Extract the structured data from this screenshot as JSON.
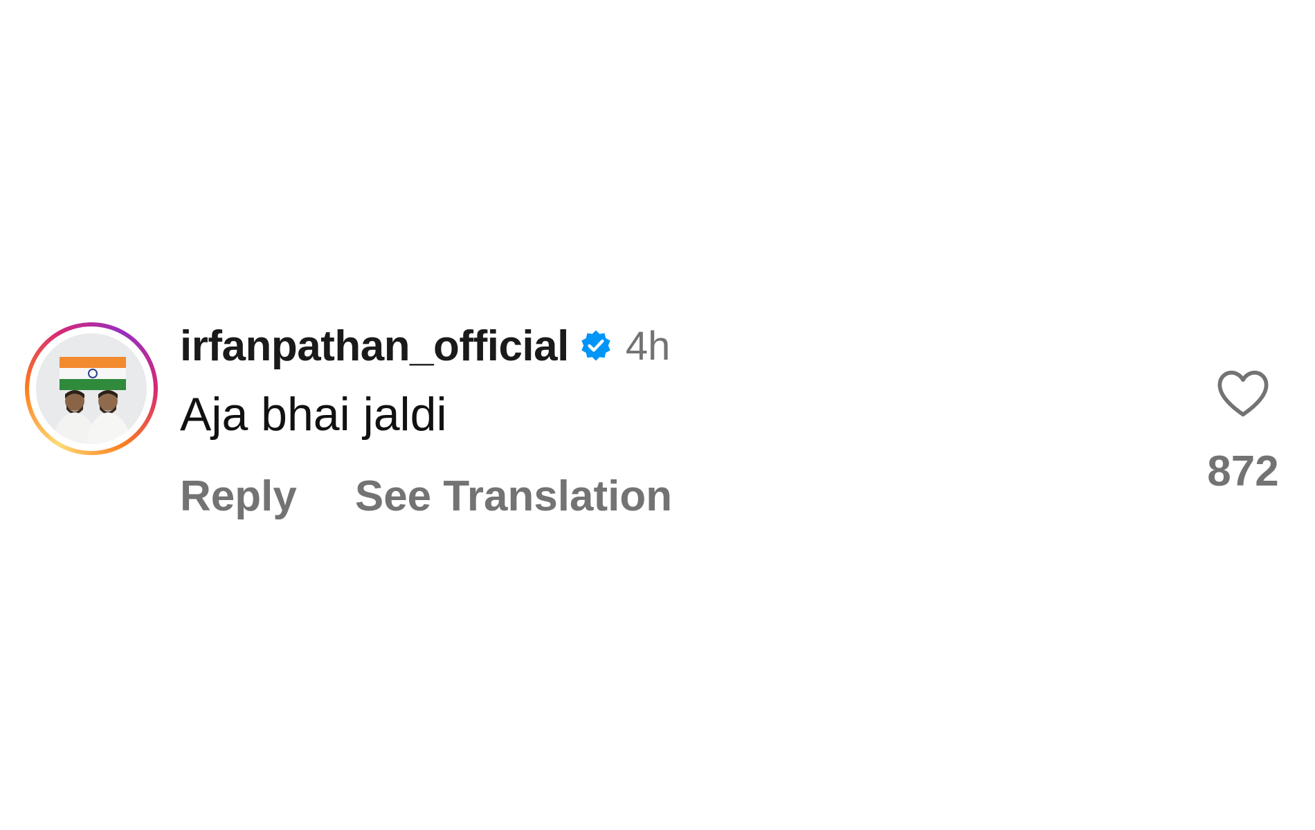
{
  "comment": {
    "username": "irfanpathan_official",
    "verified": true,
    "time": "4h",
    "text": "Aja bhai jaldi",
    "actions": {
      "reply_label": "Reply",
      "translate_label": "See Translation"
    },
    "like_count": "872"
  },
  "colors": {
    "verified_badge": "#0095f6",
    "secondary_text": "#737373",
    "primary_text": "#1a1a1a"
  },
  "icons": {
    "verified": "verified-badge-icon",
    "like": "heart-outline-icon"
  }
}
